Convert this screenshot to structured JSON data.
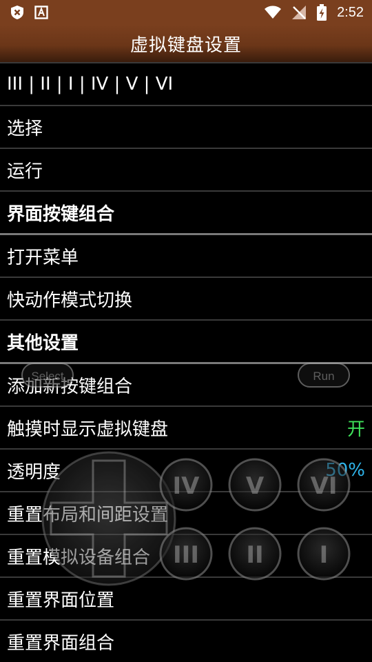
{
  "status_bar": {
    "time": "2:52",
    "left_icons": [
      "shield-close-icon",
      "text-a-icon"
    ],
    "right_icons": [
      "wifi-icon",
      "no-signal-icon",
      "battery-charging-icon"
    ]
  },
  "title": "虚拟键盘设置",
  "rows": [
    {
      "label": "III | II | I | IV | V | VI"
    },
    {
      "label": "选择"
    },
    {
      "label": "运行"
    },
    {
      "label": "界面按键组合",
      "section": true
    },
    {
      "label": "打开菜单"
    },
    {
      "label": "快动作模式切换"
    },
    {
      "label": "其他设置",
      "section": true
    },
    {
      "label": "添加新按键组合"
    },
    {
      "label": "触摸时显示虚拟键盘",
      "value": "开"
    },
    {
      "label": "透明度",
      "value": "50%"
    },
    {
      "label": "重置布局和间距设置"
    },
    {
      "label": "重置模拟设备组合"
    },
    {
      "label": "重置界面位置"
    },
    {
      "label": "重置界面组合"
    }
  ],
  "virtual_buttons": {
    "select": "Select",
    "run": "Run",
    "top_row": [
      "IV",
      "V",
      "VI"
    ],
    "bottom_row": [
      "III",
      "II",
      "I"
    ]
  },
  "colors": {
    "status_bar": "#7a3f1e",
    "value_on": "#3fe05a",
    "value_percent": "#2fb4ea"
  }
}
